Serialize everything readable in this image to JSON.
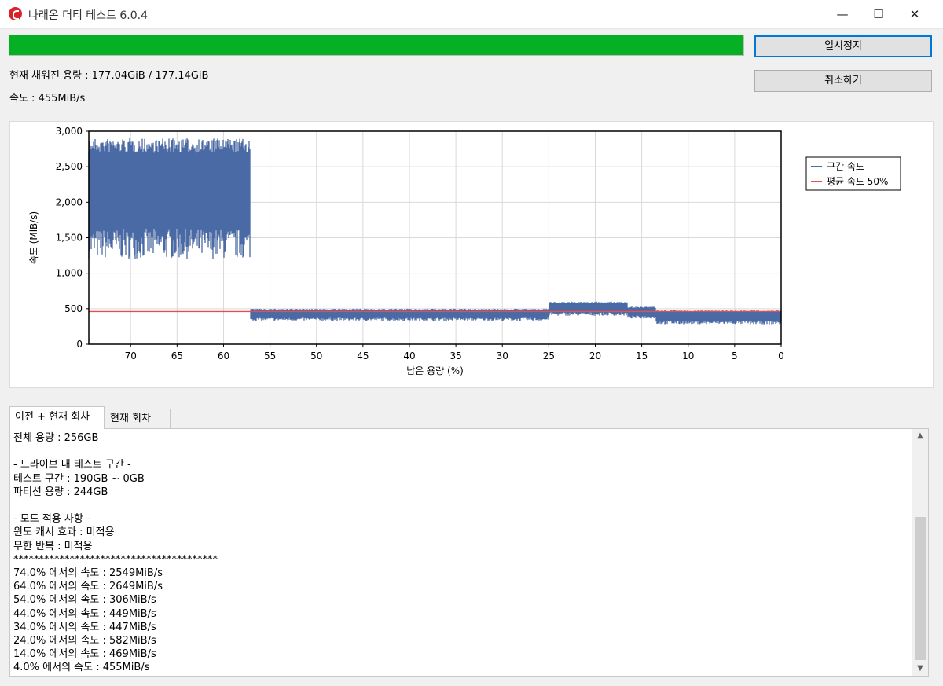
{
  "window": {
    "title": "나래온 더티 테스트 6.0.4",
    "minimize_icon": "minimize-icon",
    "maximize_icon": "maximize-icon",
    "close_icon": "close-icon"
  },
  "progress": {
    "value_pct": 99.94,
    "color": "#06b025"
  },
  "buttons": {
    "pause": "일시정지",
    "cancel": "취소하기"
  },
  "stats": {
    "capacity": "현재 채워진 용량 : 177.04GiB / 177.14GiB",
    "speed": "속도 : 455MiB/s"
  },
  "chart_data": {
    "type": "line",
    "xlabel": "남은 용량 (%)",
    "ylabel": "속도 (MiB/s)",
    "xlim": [
      74.5,
      0
    ],
    "ylim": [
      0,
      3000
    ],
    "x_ticks": [
      70,
      65,
      60,
      55,
      50,
      45,
      40,
      35,
      30,
      25,
      20,
      15,
      10,
      5,
      0
    ],
    "y_ticks": [
      "0",
      "500",
      "1,000",
      "1,500",
      "2,000",
      "2,500",
      "3,000"
    ],
    "grid": true,
    "legend_position": "right",
    "legend": [
      {
        "name": "구간 속도",
        "color": "#4a6aa5"
      },
      {
        "name": "평균 속도 50%",
        "color": "#e05050"
      }
    ],
    "series": [
      {
        "name": "구간 속도",
        "color": "#4a6aa5",
        "band": [
          {
            "x_start": 74.5,
            "x_end": 57.1,
            "low": 1200,
            "high": 2900
          },
          {
            "x_start": 57.1,
            "x_end": 25.0,
            "low": 330,
            "high": 500
          },
          {
            "x_start": 25.0,
            "x_end": 16.5,
            "low": 400,
            "high": 600
          },
          {
            "x_start": 16.5,
            "x_end": 13.5,
            "low": 360,
            "high": 530
          },
          {
            "x_start": 13.5,
            "x_end": 0,
            "low": 280,
            "high": 480
          }
        ]
      },
      {
        "name": "평균 속도 50%",
        "color": "#e05050",
        "value": 460
      }
    ]
  },
  "tabs": {
    "all": "이전 + 현재 회차",
    "current": "현재 회차"
  },
  "log": {
    "lines": [
      "전체 용량 : 256GB",
      "",
      "- 드라이브 내 테스트 구간 -",
      "테스트 구간 : 190GB ~ 0GB",
      "파티션 용량 : 244GB",
      "",
      "- 모드 적용 사항 -",
      "윈도 캐시 효과 : 미적용",
      "무한 반복 : 미적용",
      "****************************************",
      "74.0% 에서의 속도 : 2549MiB/s",
      "64.0% 에서의 속도 : 2649MiB/s",
      "54.0% 에서의 속도 : 306MiB/s",
      "44.0% 에서의 속도 : 449MiB/s",
      "34.0% 에서의 속도 : 447MiB/s",
      "24.0% 에서의 속도 : 582MiB/s",
      "14.0% 에서의 속도 : 469MiB/s",
      "4.0% 에서의 속도 : 455MiB/s"
    ]
  }
}
